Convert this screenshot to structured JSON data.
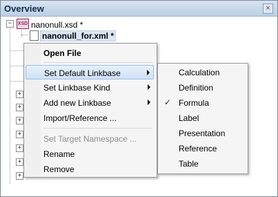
{
  "panel": {
    "title": "Overview",
    "close_glyph": "×"
  },
  "tree": {
    "root": {
      "label": "nanonull.xsd *",
      "icon": "xsd-file-icon",
      "expander": "−"
    },
    "child": {
      "label": "nanonull_for.xml *",
      "icon": "xml-file-icon"
    },
    "collapsed_expander": "+"
  },
  "context_menu": {
    "items": [
      {
        "label": "Open File",
        "bold": true
      },
      {
        "label": "Set Default Linkbase",
        "submenu": true,
        "highlighted": true
      },
      {
        "label": "Set Linkbase Kind",
        "submenu": true
      },
      {
        "label": "Add new Linkbase",
        "submenu": true
      },
      {
        "label": "Import/Reference ..."
      },
      {
        "label": "Set Target Namespace ...",
        "disabled": true
      },
      {
        "label": "Rename"
      },
      {
        "label": "Remove"
      }
    ]
  },
  "submenu": {
    "items": [
      {
        "label": "Calculation"
      },
      {
        "label": "Definition"
      },
      {
        "label": "Formula",
        "checked": true
      },
      {
        "label": "Label"
      },
      {
        "label": "Presentation"
      },
      {
        "label": "Reference"
      },
      {
        "label": "Table"
      }
    ],
    "check_glyph": "✓"
  }
}
